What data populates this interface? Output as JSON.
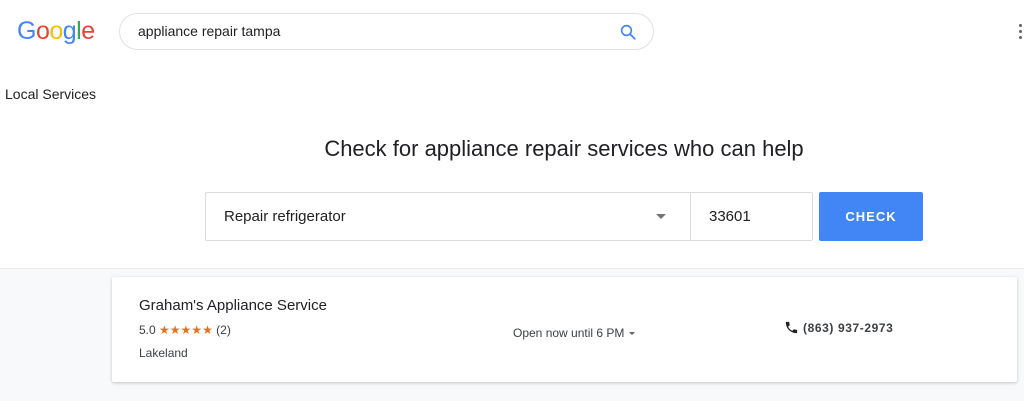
{
  "header": {
    "logo_letters": [
      {
        "char": "G",
        "color": "#4285F4"
      },
      {
        "char": "o",
        "color": "#EA4335"
      },
      {
        "char": "o",
        "color": "#FBBC05"
      },
      {
        "char": "g",
        "color": "#4285F4"
      },
      {
        "char": "l",
        "color": "#34A853"
      },
      {
        "char": "e",
        "color": "#EA4335"
      }
    ],
    "search_query": "appliance repair tampa",
    "search_icon": "search-icon",
    "menu_icon": "more-vertical-icon"
  },
  "section_title": "Local Services",
  "check_form": {
    "headline": "Check for appliance repair services who can help",
    "service_value": "Repair refrigerator",
    "zip_value": "33601",
    "button_label": "CHECK",
    "button_color": "#4285f4"
  },
  "results": [
    {
      "name": "Graham's Appliance Service",
      "rating": "5.0",
      "stars": "★★★★★",
      "review_count": "(2)",
      "location": "Lakeland",
      "hours": "Open now until 6 PM",
      "phone": "(863) 937-2973",
      "star_color": "#e7711b"
    }
  ]
}
